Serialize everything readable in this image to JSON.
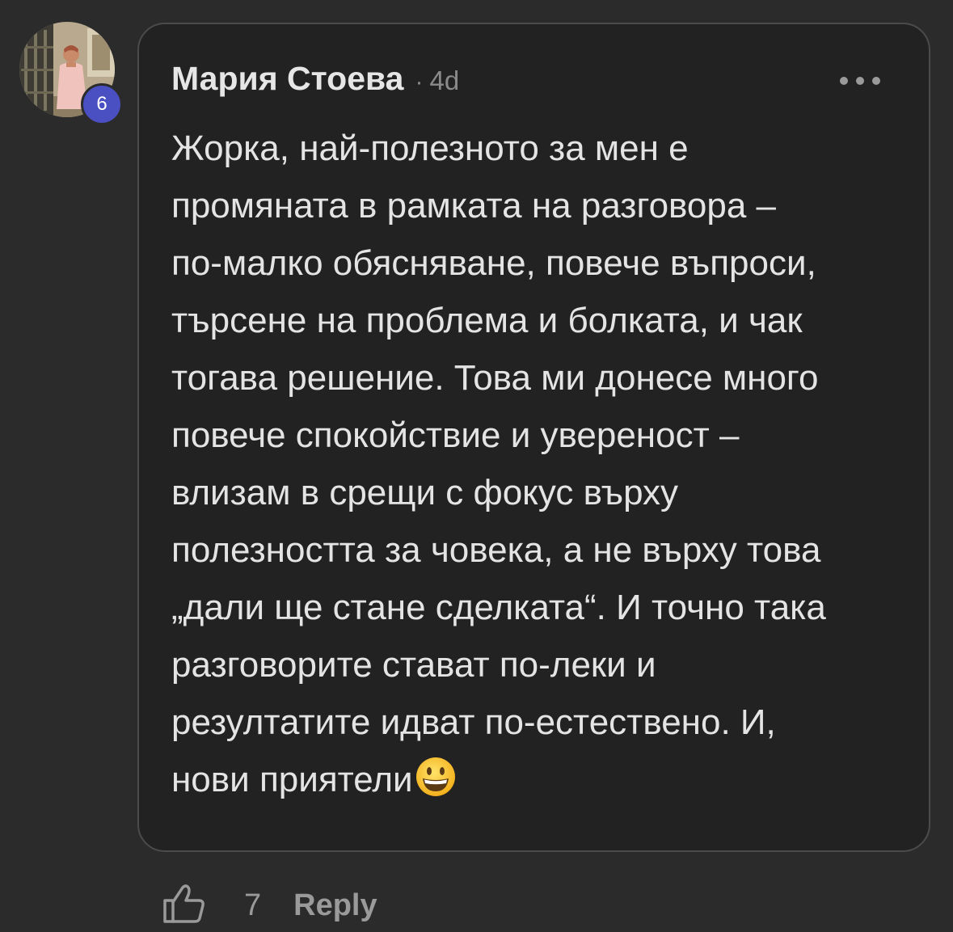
{
  "author": {
    "name": "Мария Стоева",
    "level": "6",
    "meta_separator": "·",
    "timestamp": "4d"
  },
  "comment": {
    "lines": [
      "Жорка, най-полезното за мен е",
      "промяната в рамката на разговора –",
      "по-малко обясняване, повече въпроси,",
      "търсене на проблема и болката, и чак",
      "тогава решение. Това ми донесе много",
      "повече спокойствие и увереност –",
      "влизам в срещи с фокус върху",
      "полезността за човека, а не върху това",
      "„дали ще стане сделката“. И точно така",
      "разговорите стават по-леки и",
      "резултатите идват по-естествено. И,",
      "нови приятели"
    ],
    "trailing_emoji": "grinning-face-icon"
  },
  "actions": {
    "like_icon": "thumbs-up-icon",
    "like_count": "7",
    "reply_label": "Reply"
  },
  "header": {
    "more_icon": "more-options-icon"
  },
  "colors": {
    "background": "#2b2b2b",
    "card": "#222222",
    "card_border": "#4b4b4b",
    "text": "#e4e4e4",
    "muted": "#9a9a9a",
    "level_badge": "#4a4fc1"
  }
}
